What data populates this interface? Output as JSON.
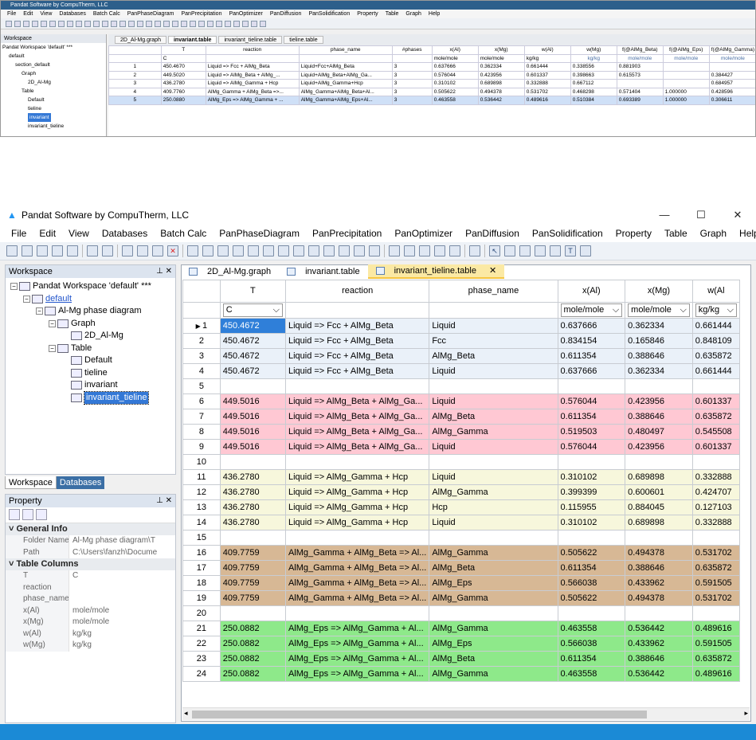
{
  "top_screenshot": {
    "title": "Pandat Software by CompuTherm, LLC",
    "menu": [
      "File",
      "Edit",
      "View",
      "Databases",
      "Batch Calc",
      "PanPhaseDiagram",
      "PanPrecipitation",
      "PanOptimizer",
      "PanDiffusion",
      "PanSolidification",
      "Property",
      "Table",
      "Graph",
      "Help"
    ],
    "workspace_title": "Workspace",
    "tree": [
      "Pandat Workspace 'default' ***",
      "default",
      "section_default",
      "Graph",
      "2D_Al-Mg",
      "Table",
      "Default",
      "tieline",
      "invariant",
      "invariant_tieline"
    ],
    "tabs": [
      "2D_Al-Mg.graph",
      "invariant.table",
      "invariant_tieline.table",
      "tieline.table"
    ],
    "headers": [
      "T",
      "reaction",
      "phase_name",
      "#phases",
      "x(Al)",
      "x(Mg)",
      "w(Al)",
      "w(Mg)",
      "f(@AlMg_Beta)",
      "f(@AlMg_Eps)",
      "f(@AlMg_Gamma)"
    ],
    "units": [
      "C",
      "",
      "",
      "",
      "mole/mole",
      "mole/mole",
      "kg/kg",
      "kg/kg",
      "mole/mole",
      "mole/mole",
      "mole/mole"
    ],
    "rows": [
      [
        "1",
        "450.4670",
        "Liquid => Fcc + AlMg_Beta",
        "Liquid+Fcc+AlMg_Beta",
        "3",
        "0.637666",
        "0.362334",
        "0.661444",
        "0.338556",
        "0.881903",
        "",
        ""
      ],
      [
        "2",
        "449.5020",
        "Liquid => AlMg_Beta + AlMg_...",
        "Liquid+AlMg_Beta+AlMg_Ga...",
        "3",
        "0.576044",
        "0.423956",
        "0.601337",
        "0.398663",
        "0.615573",
        "",
        "0.384427"
      ],
      [
        "3",
        "436.2780",
        "Liquid => AlMg_Gamma + Hcp",
        "Liquid+AlMg_Gamma+Hcp",
        "3",
        "0.310102",
        "0.689898",
        "0.332888",
        "0.667112",
        "",
        "",
        "0.684957"
      ],
      [
        "4",
        "409.7760",
        "AlMg_Gamma + AlMg_Beta =>...",
        "AlMg_Gamma+AlMg_Beta+Al...",
        "3",
        "0.505622",
        "0.494378",
        "0.531702",
        "0.468298",
        "0.571404",
        "1.000000",
        "0.428596"
      ],
      [
        "5",
        "250.0880",
        "AlMg_Eps => AlMg_Gamma + ...",
        "AlMg_Gamma+AlMg_Eps+Al...",
        "3",
        "0.463558",
        "0.536442",
        "0.489616",
        "0.510384",
        "0.693389",
        "1.000000",
        "0.306611"
      ]
    ]
  },
  "app": {
    "title": "Pandat Software by CompuTherm, LLC",
    "window_buttons": {
      "minimize": "—",
      "maximize": "☐",
      "close": "✕"
    },
    "menu": [
      "File",
      "Edit",
      "View",
      "Databases",
      "Batch Calc",
      "PanPhaseDiagram",
      "PanPrecipitation",
      "PanOptimizer",
      "PanDiffusion",
      "PanSolidification",
      "Property",
      "Table",
      "Graph",
      "Help"
    ],
    "workspace": {
      "title": "Workspace",
      "tree": {
        "root": "Pandat Workspace 'default' ***",
        "default": "default",
        "phase_diagram": "Al-Mg phase diagram",
        "graph": "Graph",
        "graph_item": "2D_Al-Mg",
        "table": "Table",
        "tables": [
          "Default",
          "tieline",
          "invariant",
          "invariant_tieline"
        ]
      },
      "bottom_tabs": [
        "Workspace",
        "Databases"
      ]
    },
    "property": {
      "title": "Property",
      "general_info": "General Info",
      "folder_name_label": "Folder Name",
      "folder_name_value": "Al-Mg phase diagram\\T",
      "path_label": "Path",
      "path_value": "C:\\Users\\fanzh\\Docume",
      "table_columns": "Table Columns",
      "columns": [
        {
          "k": "T",
          "v": "C"
        },
        {
          "k": "reaction",
          "v": ""
        },
        {
          "k": "phase_name",
          "v": ""
        },
        {
          "k": "x(Al)",
          "v": "mole/mole"
        },
        {
          "k": "x(Mg)",
          "v": "mole/mole"
        },
        {
          "k": "w(Al)",
          "v": "kg/kg"
        },
        {
          "k": "w(Mg)",
          "v": "kg/kg"
        }
      ]
    },
    "doc_tabs": [
      "2D_Al-Mg.graph",
      "invariant.table",
      "invariant_tieline.table"
    ],
    "table": {
      "headers": [
        "T",
        "reaction",
        "phase_name",
        "x(Al)",
        "x(Mg)",
        "w(Al"
      ],
      "unit_selects": [
        "C",
        "",
        "",
        "mole/mole",
        "mole/mole",
        "kg/kg"
      ],
      "rows": [
        {
          "n": "1",
          "g": "blue",
          "c": [
            "450.4672",
            "Liquid => Fcc + AlMg_Beta",
            "Liquid",
            "0.637666",
            "0.362334",
            "0.661444"
          ]
        },
        {
          "n": "2",
          "g": "blue",
          "c": [
            "450.4672",
            "Liquid => Fcc + AlMg_Beta",
            "Fcc",
            "0.834154",
            "0.165846",
            "0.848109"
          ]
        },
        {
          "n": "3",
          "g": "blue",
          "c": [
            "450.4672",
            "Liquid => Fcc + AlMg_Beta",
            "AlMg_Beta",
            "0.611354",
            "0.388646",
            "0.635872"
          ]
        },
        {
          "n": "4",
          "g": "blue",
          "c": [
            "450.4672",
            "Liquid => Fcc + AlMg_Beta",
            "Liquid",
            "0.637666",
            "0.362334",
            "0.661444"
          ]
        },
        {
          "n": "5",
          "g": "empty",
          "c": [
            "",
            "",
            "",
            "",
            "",
            ""
          ]
        },
        {
          "n": "6",
          "g": "pink",
          "c": [
            "449.5016",
            "Liquid => AlMg_Beta + AlMg_Ga...",
            "Liquid",
            "0.576044",
            "0.423956",
            "0.601337"
          ]
        },
        {
          "n": "7",
          "g": "pink",
          "c": [
            "449.5016",
            "Liquid => AlMg_Beta + AlMg_Ga...",
            "AlMg_Beta",
            "0.611354",
            "0.388646",
            "0.635872"
          ]
        },
        {
          "n": "8",
          "g": "pink",
          "c": [
            "449.5016",
            "Liquid => AlMg_Beta + AlMg_Ga...",
            "AlMg_Gamma",
            "0.519503",
            "0.480497",
            "0.545508"
          ]
        },
        {
          "n": "9",
          "g": "pink",
          "c": [
            "449.5016",
            "Liquid => AlMg_Beta + AlMg_Ga...",
            "Liquid",
            "0.576044",
            "0.423956",
            "0.601337"
          ]
        },
        {
          "n": "10",
          "g": "empty",
          "c": [
            "",
            "",
            "",
            "",
            "",
            ""
          ]
        },
        {
          "n": "11",
          "g": "yel",
          "c": [
            "436.2780",
            "Liquid => AlMg_Gamma + Hcp",
            "Liquid",
            "0.310102",
            "0.689898",
            "0.332888"
          ]
        },
        {
          "n": "12",
          "g": "yel",
          "c": [
            "436.2780",
            "Liquid => AlMg_Gamma + Hcp",
            "AlMg_Gamma",
            "0.399399",
            "0.600601",
            "0.424707"
          ]
        },
        {
          "n": "13",
          "g": "yel",
          "c": [
            "436.2780",
            "Liquid => AlMg_Gamma + Hcp",
            "Hcp",
            "0.115955",
            "0.884045",
            "0.127103"
          ]
        },
        {
          "n": "14",
          "g": "yel",
          "c": [
            "436.2780",
            "Liquid => AlMg_Gamma + Hcp",
            "Liquid",
            "0.310102",
            "0.689898",
            "0.332888"
          ]
        },
        {
          "n": "15",
          "g": "empty",
          "c": [
            "",
            "",
            "",
            "",
            "",
            ""
          ]
        },
        {
          "n": "16",
          "g": "brown",
          "c": [
            "409.7759",
            "AlMg_Gamma + AlMg_Beta => Al...",
            "AlMg_Gamma",
            "0.505622",
            "0.494378",
            "0.531702"
          ]
        },
        {
          "n": "17",
          "g": "brown",
          "c": [
            "409.7759",
            "AlMg_Gamma + AlMg_Beta => Al...",
            "AlMg_Beta",
            "0.611354",
            "0.388646",
            "0.635872"
          ]
        },
        {
          "n": "18",
          "g": "brown",
          "c": [
            "409.7759",
            "AlMg_Gamma + AlMg_Beta => Al...",
            "AlMg_Eps",
            "0.566038",
            "0.433962",
            "0.591505"
          ]
        },
        {
          "n": "19",
          "g": "brown",
          "c": [
            "409.7759",
            "AlMg_Gamma + AlMg_Beta => Al...",
            "AlMg_Gamma",
            "0.505622",
            "0.494378",
            "0.531702"
          ]
        },
        {
          "n": "20",
          "g": "empty",
          "c": [
            "",
            "",
            "",
            "",
            "",
            ""
          ]
        },
        {
          "n": "21",
          "g": "green",
          "c": [
            "250.0882",
            "AlMg_Eps => AlMg_Gamma + Al...",
            "AlMg_Gamma",
            "0.463558",
            "0.536442",
            "0.489616"
          ]
        },
        {
          "n": "22",
          "g": "green",
          "c": [
            "250.0882",
            "AlMg_Eps => AlMg_Gamma + Al...",
            "AlMg_Eps",
            "0.566038",
            "0.433962",
            "0.591505"
          ]
        },
        {
          "n": "23",
          "g": "green",
          "c": [
            "250.0882",
            "AlMg_Eps => AlMg_Gamma + Al...",
            "AlMg_Beta",
            "0.611354",
            "0.388646",
            "0.635872"
          ]
        },
        {
          "n": "24",
          "g": "green",
          "c": [
            "250.0882",
            "AlMg_Eps => AlMg_Gamma + Al...",
            "AlMg_Gamma",
            "0.463558",
            "0.536442",
            "0.489616"
          ]
        }
      ]
    },
    "colors": {
      "blue_group": "#eaf1f9",
      "pink_group": "#ffc8d3",
      "yellow_group": "#f7f7dc",
      "brown_group": "#d7b895",
      "green_group": "#8ee98a",
      "status_bar": "#1b8ad6",
      "selection": "#2f7fd9"
    }
  }
}
